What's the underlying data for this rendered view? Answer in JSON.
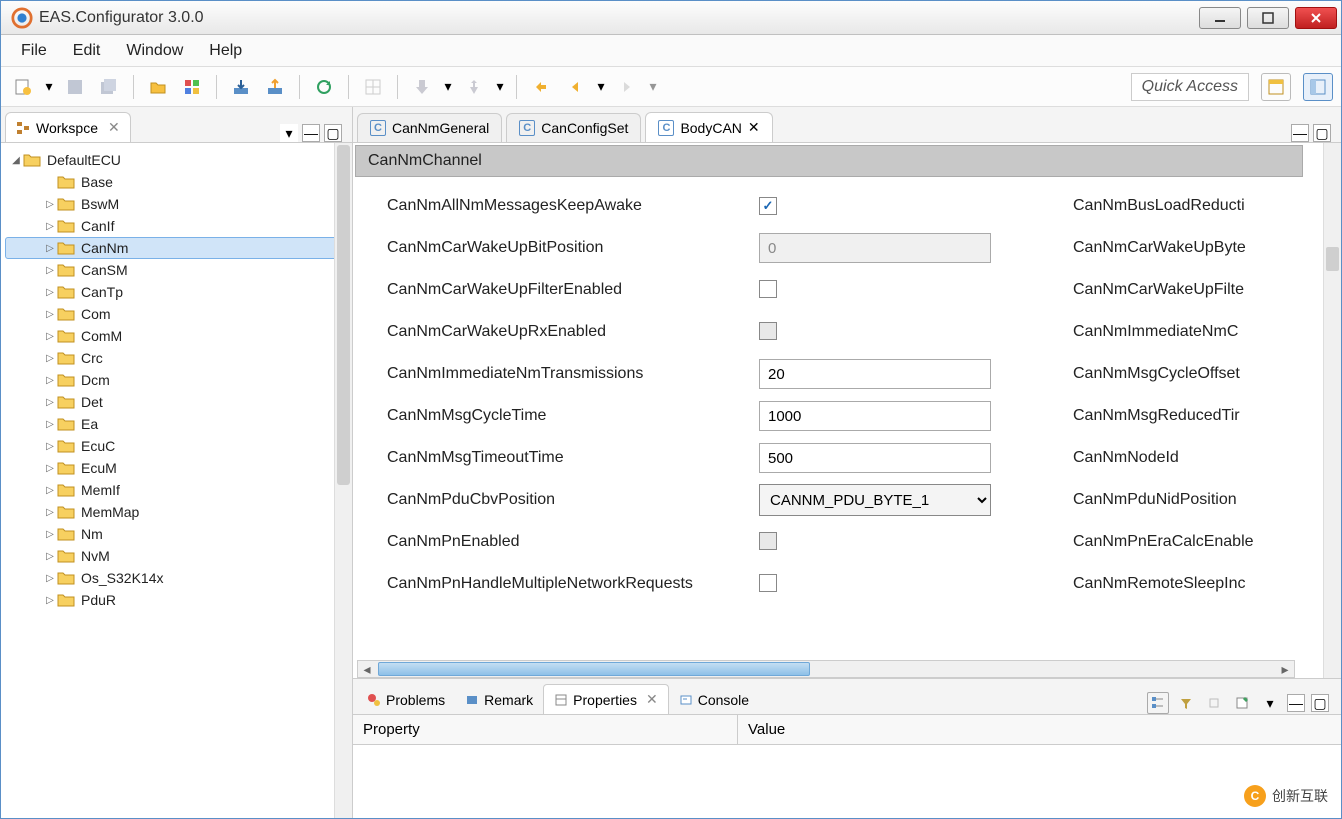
{
  "window": {
    "title": "EAS.Configurator 3.0.0"
  },
  "menus": [
    "File",
    "Edit",
    "Window",
    "Help"
  ],
  "toolbar": {
    "quick_access": "Quick Access"
  },
  "workspace": {
    "tab_label": "Workspce",
    "root": "DefaultECU",
    "items": [
      {
        "label": "Base",
        "expandable": false
      },
      {
        "label": "BswM",
        "expandable": true
      },
      {
        "label": "CanIf",
        "expandable": true
      },
      {
        "label": "CanNm",
        "expandable": true,
        "selected": true
      },
      {
        "label": "CanSM",
        "expandable": true
      },
      {
        "label": "CanTp",
        "expandable": true
      },
      {
        "label": "Com",
        "expandable": true
      },
      {
        "label": "ComM",
        "expandable": true
      },
      {
        "label": "Crc",
        "expandable": true
      },
      {
        "label": "Dcm",
        "expandable": true
      },
      {
        "label": "Det",
        "expandable": true
      },
      {
        "label": "Ea",
        "expandable": true
      },
      {
        "label": "EcuC",
        "expandable": true
      },
      {
        "label": "EcuM",
        "expandable": true
      },
      {
        "label": "MemIf",
        "expandable": true
      },
      {
        "label": "MemMap",
        "expandable": true
      },
      {
        "label": "Nm",
        "expandable": true
      },
      {
        "label": "NvM",
        "expandable": true
      },
      {
        "label": "Os_S32K14x",
        "expandable": true
      },
      {
        "label": "PduR",
        "expandable": true
      }
    ]
  },
  "editor": {
    "tabs": [
      {
        "label": "CanNmGeneral",
        "closable": false
      },
      {
        "label": "CanConfigSet",
        "closable": false
      },
      {
        "label": "BodyCAN",
        "closable": true,
        "active": true
      }
    ],
    "section": "CanNmChannel",
    "rows": [
      {
        "label": "CanNmAllNmMessagesKeepAwake",
        "type": "check",
        "checked": true,
        "label2": "CanNmBusLoadReducti"
      },
      {
        "label": "CanNmCarWakeUpBitPosition",
        "type": "text",
        "value": "0",
        "disabled": true,
        "label2": "CanNmCarWakeUpByte"
      },
      {
        "label": "CanNmCarWakeUpFilterEnabled",
        "type": "check",
        "checked": false,
        "label2": "CanNmCarWakeUpFilte"
      },
      {
        "label": "CanNmCarWakeUpRxEnabled",
        "type": "check",
        "checked": false,
        "disabled": true,
        "label2": "CanNmImmediateNmC"
      },
      {
        "label": "CanNmImmediateNmTransmissions",
        "type": "text",
        "value": "20",
        "label2": "CanNmMsgCycleOffset"
      },
      {
        "label": "CanNmMsgCycleTime",
        "type": "text",
        "value": "1000",
        "label2": "CanNmMsgReducedTir"
      },
      {
        "label": "CanNmMsgTimeoutTime",
        "type": "text",
        "value": "500",
        "label2": "CanNmNodeId"
      },
      {
        "label": "CanNmPduCbvPosition",
        "type": "select",
        "value": "CANNM_PDU_BYTE_1",
        "label2": "CanNmPduNidPosition"
      },
      {
        "label": "CanNmPnEnabled",
        "type": "check",
        "checked": false,
        "disabled": true,
        "label2": "CanNmPnEraCalcEnable"
      },
      {
        "label": "CanNmPnHandleMultipleNetworkRequests",
        "type": "check",
        "checked": false,
        "label2": "CanNmRemoteSleepInc"
      }
    ]
  },
  "bottom": {
    "tabs": [
      "Problems",
      "Remark",
      "Properties",
      "Console"
    ],
    "active": 2,
    "columns": [
      "Property",
      "Value"
    ]
  },
  "watermark": "创新互联"
}
